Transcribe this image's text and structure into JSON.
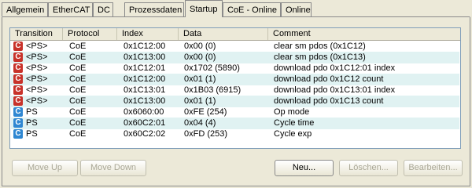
{
  "tabs": [
    {
      "label": "Allgemein"
    },
    {
      "label": "EtherCAT"
    },
    {
      "label": "DC"
    },
    {
      "label": "Prozessdaten"
    },
    {
      "label": "Startup"
    },
    {
      "label": "CoE - Online"
    },
    {
      "label": "Online"
    }
  ],
  "active_tab": "Startup",
  "columns": [
    "Transition",
    "Protocol",
    "Index",
    "Data",
    "Comment"
  ],
  "rows": [
    {
      "icon": "C",
      "icon_color": "red",
      "transition": "<PS>",
      "protocol": "CoE",
      "index": "0x1C12:00",
      "data": "0x00 (0)",
      "comment": "clear sm pdos (0x1C12)"
    },
    {
      "icon": "C",
      "icon_color": "red",
      "transition": "<PS>",
      "protocol": "CoE",
      "index": "0x1C13:00",
      "data": "0x00 (0)",
      "comment": "clear sm pdos (0x1C13)"
    },
    {
      "icon": "C",
      "icon_color": "red",
      "transition": "<PS>",
      "protocol": "CoE",
      "index": "0x1C12:01",
      "data": "0x1702 (5890)",
      "comment": "download pdo 0x1C12:01 index"
    },
    {
      "icon": "C",
      "icon_color": "red",
      "transition": "<PS>",
      "protocol": "CoE",
      "index": "0x1C12:00",
      "data": "0x01 (1)",
      "comment": "download pdo 0x1C12 count"
    },
    {
      "icon": "C",
      "icon_color": "red",
      "transition": "<PS>",
      "protocol": "CoE",
      "index": "0x1C13:01",
      "data": "0x1B03 (6915)",
      "comment": "download pdo 0x1C13:01 index"
    },
    {
      "icon": "C",
      "icon_color": "red",
      "transition": "<PS>",
      "protocol": "CoE",
      "index": "0x1C13:00",
      "data": "0x01 (1)",
      "comment": "download pdo 0x1C13 count"
    },
    {
      "icon": "C",
      "icon_color": "blue",
      "transition": "PS",
      "protocol": "CoE",
      "index": "0x6060:00",
      "data": "0xFE (254)",
      "comment": "Op mode"
    },
    {
      "icon": "C",
      "icon_color": "blue",
      "transition": "PS",
      "protocol": "CoE",
      "index": "0x60C2:01",
      "data": "0x04 (4)",
      "comment": "Cycle time"
    },
    {
      "icon": "C",
      "icon_color": "blue",
      "transition": "PS",
      "protocol": "CoE",
      "index": "0x60C2:02",
      "data": "0xFD (253)",
      "comment": "Cycle exp"
    }
  ],
  "buttons": {
    "move_up": "Move Up",
    "move_down": "Move Down",
    "new": "Neu...",
    "delete": "Löschen...",
    "edit": "Bearbeiten..."
  },
  "colors": {
    "row_alt": "#e0f2f2",
    "icon_red": "#c8322a",
    "icon_blue": "#2f87d2"
  }
}
